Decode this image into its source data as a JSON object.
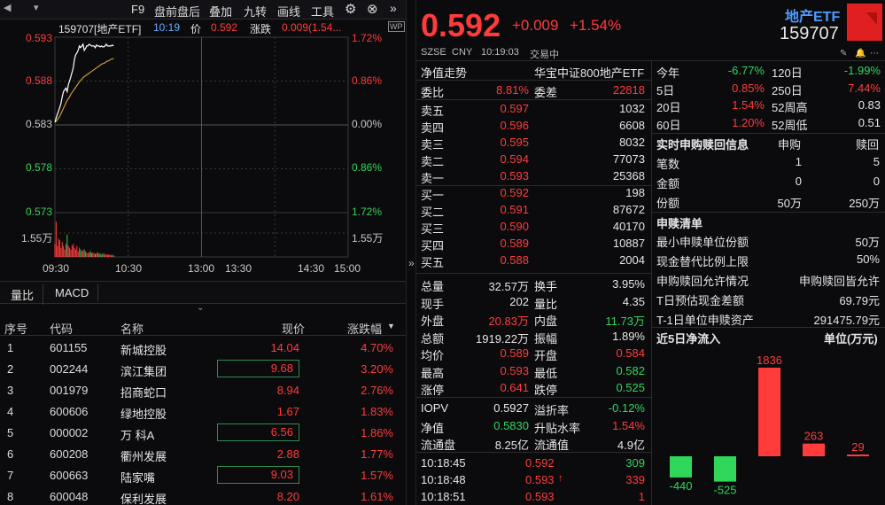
{
  "topbar": {
    "items": [
      "F9",
      "盘前盘后",
      "叠加",
      "九转",
      "画线",
      "工具"
    ]
  },
  "chart": {
    "header": {
      "code_name": "159707[地产ETF]",
      "time": "10:19",
      "price_label": "价",
      "price": "0.592",
      "change_label": "涨跌",
      "change": "0.009(1.54..."
    },
    "y_left": [
      "0.593",
      "0.588",
      "0.583",
      "0.578",
      "0.573"
    ],
    "y_right": [
      "1.72%",
      "0.86%",
      "0.00%",
      "0.86%",
      "1.72%"
    ],
    "volume_left": "1.55万",
    "volume_right": "1.55万",
    "x_ticks": [
      "09:30",
      "10:30",
      "13:00",
      "13:30",
      "14:30",
      "15:00"
    ],
    "price_series": [
      0.5833,
      0.5838,
      0.5842,
      0.5846,
      0.585,
      0.5855,
      0.5862,
      0.5868,
      0.587,
      0.5872,
      0.5868,
      0.5876,
      0.588,
      0.5885,
      0.589,
      0.5895,
      0.5905,
      0.591,
      0.5912,
      0.5915,
      0.592,
      0.5918,
      0.592,
      0.5922,
      0.5915,
      0.5917,
      0.592,
      0.592,
      0.5922,
      0.5921,
      0.592,
      0.592,
      0.592,
      0.5918,
      0.5921,
      0.592,
      0.592,
      0.5919,
      0.592,
      0.5919,
      0.5919,
      0.592,
      0.5922,
      0.592,
      0.592,
      0.592,
      0.592,
      0.5921,
      0.592
    ],
    "avg_series": [
      0.5833,
      0.5834,
      0.5836,
      0.5838,
      0.584,
      0.5843,
      0.5846,
      0.5849,
      0.5852,
      0.5855,
      0.5858,
      0.586,
      0.5862,
      0.5865,
      0.5867,
      0.5869,
      0.5871,
      0.5873,
      0.5875,
      0.5877,
      0.5879,
      0.5881,
      0.5882,
      0.5884,
      0.5885,
      0.5886,
      0.5887,
      0.5888,
      0.5889,
      0.589,
      0.5891,
      0.5892,
      0.5893,
      0.5894,
      0.5895,
      0.5896,
      0.5897,
      0.5898,
      0.5899,
      0.59,
      0.59,
      0.5901,
      0.5902,
      0.5903,
      0.5903,
      0.5904,
      0.5905,
      0.5905,
      0.5906
    ],
    "volume_series": [
      0.35,
      0.95,
      0.3,
      0.5,
      0.45,
      0.25,
      0.4,
      0.3,
      0.2,
      0.35,
      0.6,
      0.3,
      0.25,
      0.2,
      0.3,
      0.35,
      0.25,
      0.2,
      0.3,
      0.15,
      0.25,
      0.2,
      0.15,
      0.18,
      0.2,
      0.15,
      0.12,
      0.1,
      0.12,
      0.15,
      0.1,
      0.12,
      0.1,
      0.08,
      0.1,
      0.12,
      0.08,
      0.1,
      0.06,
      0.08,
      0.1,
      0.06,
      0.08,
      0.05,
      0.07,
      0.06,
      0.05,
      0.06,
      0.04
    ]
  },
  "tabs": [
    "量比",
    "MACD"
  ],
  "table": {
    "headers": [
      "序号",
      "代码",
      "名称",
      "现价",
      "涨跌幅"
    ],
    "rows": [
      {
        "no": "1",
        "code": "601155",
        "name": "新城控股",
        "price": "14.04",
        "pct": "4.70%"
      },
      {
        "no": "2",
        "code": "002244",
        "name": "滨江集团",
        "price": "9.68",
        "pct": "3.20%"
      },
      {
        "no": "3",
        "code": "001979",
        "name": "招商蛇口",
        "price": "8.94",
        "pct": "2.76%"
      },
      {
        "no": "4",
        "code": "600606",
        "name": "绿地控股",
        "price": "1.67",
        "pct": "1.83%"
      },
      {
        "no": "5",
        "code": "000002",
        "name": "万 科A",
        "price": "6.56",
        "pct": "1.86%"
      },
      {
        "no": "6",
        "code": "600208",
        "name": "衢州发展",
        "price": "2.88",
        "pct": "1.77%"
      },
      {
        "no": "7",
        "code": "600663",
        "name": "陆家嘴",
        "price": "9.03",
        "pct": "1.57%"
      },
      {
        "no": "8",
        "code": "600048",
        "name": "保利发展",
        "price": "8.20",
        "pct": "1.61%"
      }
    ]
  },
  "quote": {
    "price": "0.592",
    "change": "+0.009",
    "change_pct": "+1.54%",
    "name": "地产ETF",
    "code": "159707",
    "market": "SZSE",
    "currency": "CNY",
    "time": "10:19:03",
    "status": "交易中",
    "nav_trend_label": "净值走势",
    "index_name": "华宝中证800地产ETF",
    "weibi_label": "委比",
    "weibi": "8.81%",
    "weicha_label": "委差",
    "weicha": "22818",
    "asks": [
      {
        "label": "卖五",
        "price": "0.597",
        "vol": "1032"
      },
      {
        "label": "卖四",
        "price": "0.596",
        "vol": "6608"
      },
      {
        "label": "卖三",
        "price": "0.595",
        "vol": "8032"
      },
      {
        "label": "卖二",
        "price": "0.594",
        "vol": "77073"
      },
      {
        "label": "卖一",
        "price": "0.593",
        "vol": "25368"
      }
    ],
    "bids": [
      {
        "label": "买一",
        "price": "0.592",
        "vol": "198"
      },
      {
        "label": "买二",
        "price": "0.591",
        "vol": "87672"
      },
      {
        "label": "买三",
        "price": "0.590",
        "vol": "40170"
      },
      {
        "label": "买四",
        "price": "0.589",
        "vol": "10887"
      },
      {
        "label": "买五",
        "price": "0.588",
        "vol": "2004"
      }
    ],
    "stats": [
      {
        "l1": "总量",
        "v1": "32.57万",
        "c1": "white",
        "l2": "换手",
        "v2": "3.95%",
        "c2": "white"
      },
      {
        "l1": "现手",
        "v1": "202",
        "c1": "white",
        "l2": "量比",
        "v2": "4.35",
        "c2": "white"
      },
      {
        "l1": "外盘",
        "v1": "20.83万",
        "c1": "red",
        "l2": "内盘",
        "v2": "11.73万",
        "c2": "green"
      },
      {
        "l1": "总额",
        "v1": "1919.22万",
        "c1": "white",
        "l2": "振幅",
        "v2": "1.89%",
        "c2": "white"
      },
      {
        "l1": "均价",
        "v1": "0.589",
        "c1": "red",
        "l2": "开盘",
        "v2": "0.584",
        "c2": "red"
      },
      {
        "l1": "最高",
        "v1": "0.593",
        "c1": "red",
        "l2": "最低",
        "v2": "0.582",
        "c2": "green"
      },
      {
        "l1": "涨停",
        "v1": "0.641",
        "c1": "red",
        "l2": "跌停",
        "v2": "0.525",
        "c2": "green"
      }
    ],
    "stats2": [
      {
        "l1": "IOPV",
        "v1": "0.5927",
        "c1": "white",
        "l2": "溢折率",
        "v2": "-0.12%",
        "c2": "green"
      },
      {
        "l1": "净值",
        "v1": "0.5830",
        "c1": "green",
        "l2": "升贴水率",
        "v2": "1.54%",
        "c2": "red"
      },
      {
        "l1": "流通盘",
        "v1": "8.25亿",
        "c1": "white",
        "l2": "流通值",
        "v2": "4.9亿",
        "c2": "white"
      }
    ],
    "ticks": [
      {
        "time": "10:18:45",
        "price": "0.592",
        "arrow": "",
        "vol": "309",
        "vc": "green"
      },
      {
        "time": "10:18:48",
        "price": "0.593",
        "arrow": "↑",
        "vol": "339",
        "vc": "red"
      },
      {
        "time": "10:18:51",
        "price": "0.593",
        "arrow": "",
        "vol": "1",
        "vc": "red"
      }
    ]
  },
  "period": [
    {
      "l1": "今年",
      "v1": "-6.77%",
      "c1": "green",
      "l2": "120日",
      "v2": "-1.99%",
      "c2": "green"
    },
    {
      "l1": "5日",
      "v1": "0.85%",
      "c1": "red",
      "l2": "250日",
      "v2": "7.44%",
      "c2": "red"
    },
    {
      "l1": "20日",
      "v1": "1.54%",
      "c1": "red",
      "l2": "52周高",
      "v2": "0.83",
      "c2": "white"
    },
    {
      "l1": "60日",
      "v1": "1.20%",
      "c1": "red",
      "l2": "52周低",
      "v2": "0.51",
      "c2": "white"
    }
  ],
  "subscribe": {
    "title": "实时申购赎回信息",
    "col1": "申购",
    "col2": "赎回",
    "rows": [
      {
        "label": "笔数",
        "v1": "1",
        "v2": "5"
      },
      {
        "label": "金额",
        "v1": "0",
        "v2": "0"
      },
      {
        "label": "份额",
        "v1": "50万",
        "v2": "250万"
      }
    ]
  },
  "list": {
    "title": "申赎清单",
    "rows": [
      {
        "label": "最小申赎单位份额",
        "value": "50万"
      },
      {
        "label": "现金替代比例上限",
        "value": "50%"
      },
      {
        "label": "申购赎回允许情况",
        "value": "申购赎回皆允许"
      },
      {
        "label": "T日预估现金差额",
        "value": "69.79元"
      },
      {
        "label": "T-1日单位申赎资产",
        "value": "291475.79元"
      }
    ]
  },
  "flow": {
    "title": "近5日净流入",
    "unit": "单位(万元)",
    "values": [
      -440,
      -525,
      1836,
      263,
      29
    ],
    "labels": [
      "-440",
      "-525",
      "1836",
      "263",
      "29"
    ]
  },
  "colors": {
    "up": "#ff3b3b",
    "down": "#2fd65a",
    "bg": "#0b0b0d"
  }
}
